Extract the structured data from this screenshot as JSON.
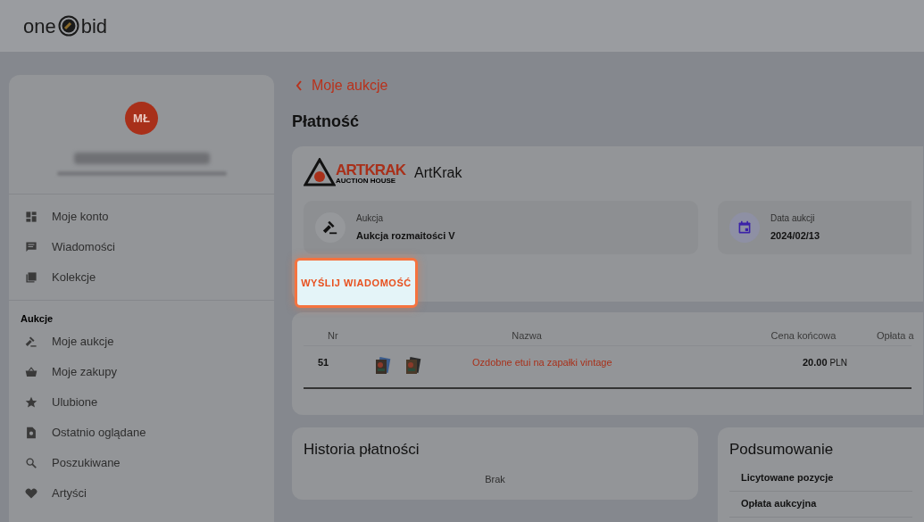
{
  "header": {
    "logo_left": "one",
    "logo_right": "bid"
  },
  "sidebar": {
    "avatar": "MŁ",
    "menu": [
      {
        "label": "Moje konto"
      },
      {
        "label": "Wiadomości"
      },
      {
        "label": "Kolekcje"
      }
    ],
    "section": "Aukcje",
    "auction_menu": [
      {
        "label": "Moje aukcje"
      },
      {
        "label": "Moje zakupy"
      },
      {
        "label": "Ulubione"
      },
      {
        "label": "Ostatnio oglądane"
      },
      {
        "label": "Poszukiwane"
      },
      {
        "label": "Artyści"
      }
    ]
  },
  "back_link": "Moje aukcje",
  "title": "Płatność",
  "seller": {
    "logo_text": "ARTKRAK",
    "logo_sub": "AUCTION HOUSE",
    "name": "ArtKrak"
  },
  "info": [
    {
      "label": "Aukcja",
      "value": "Aukcja rozmaitości V"
    },
    {
      "label": "Data aukcji",
      "value": "2024/02/13"
    }
  ],
  "message_button": "WYŚLIJ WIADOMOŚĆ",
  "table": {
    "columns": [
      "Nr",
      "Nazwa",
      "Cena końcowa",
      "Opłata a"
    ],
    "rows": [
      {
        "nr": "51",
        "name": "Ozdobne etui na zapałki vintage",
        "price": "20.00",
        "currency": "PLN"
      }
    ]
  },
  "history": {
    "title": "Historia płatności",
    "empty": "Brak"
  },
  "summary": {
    "title": "Podsumowanie",
    "rows": [
      "Licytowane pozycje",
      "Opłata aukcyjna"
    ]
  }
}
